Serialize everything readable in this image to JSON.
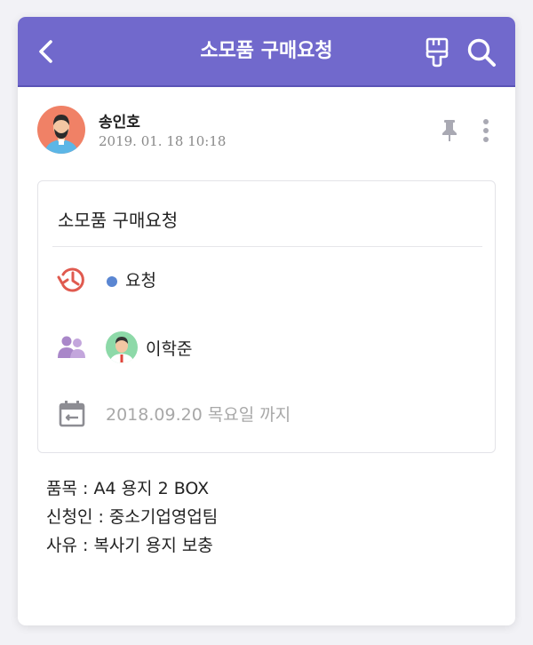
{
  "header": {
    "title": "소모품 구매요청",
    "back_icon": "chevron-left-icon",
    "brush_icon": "paint-brush-icon",
    "search_icon": "search-icon",
    "bar_color": "#7169cc"
  },
  "post": {
    "author_name": "송인호",
    "date": "2019. 01. 18 10:18",
    "avatar_icon": "male-avatar-icon",
    "pin_icon": "pin-icon",
    "more_icon": "more-vertical-icon"
  },
  "request_card": {
    "title": "소모품 구매요청",
    "status_icon": "history-clock-icon",
    "status_label": "요청",
    "status_color": "#5a86d2",
    "assignee_icon": "people-icon",
    "assignee_name": "이학준",
    "due_icon": "calendar-icon",
    "due_text": "2018.09.20 목요일 까지"
  },
  "details": {
    "lines": [
      "품목 : A4 용지 2 BOX",
      "신청인 : 중소기업영업팀",
      "사유 : 복사기 용지 보충"
    ]
  }
}
